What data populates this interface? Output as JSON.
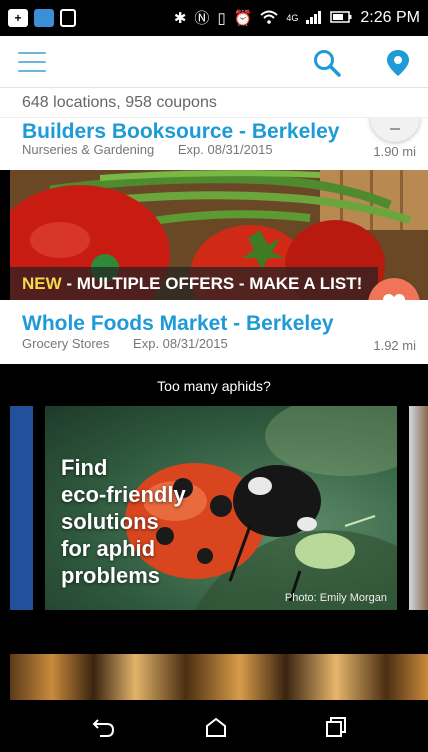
{
  "status_bar": {
    "time": "2:26 PM",
    "network": "4G",
    "icons": [
      "add-icon",
      "app-notification-icon",
      "document-icon",
      "bluetooth-icon",
      "nfc-icon",
      "vibrate-icon",
      "alarm-icon",
      "wifi-icon",
      "signal-icon",
      "battery-icon"
    ]
  },
  "header": {
    "icons": [
      "menu-icon",
      "search-icon",
      "location-pin-icon"
    ],
    "accent_color": "#1e9bd7"
  },
  "summary": {
    "locations_count": "648",
    "locations_label": "locations,",
    "coupons_count": "958",
    "coupons_label": "coupons"
  },
  "listings": [
    {
      "name": "Builders Booksource - Berkeley",
      "category": "Nurseries & Gardening",
      "expires": "Exp. 08/31/2015",
      "distance": "1.90 mi"
    },
    {
      "banner_new": "NEW",
      "banner_text": " - MULTIPLE OFFERS - MAKE A LIST!",
      "name": "Whole Foods Market - Berkeley",
      "category": "Grocery Stores",
      "expires": "Exp. 08/31/2015",
      "distance": "1.92 mi"
    }
  ],
  "promo": {
    "heading": "Too many aphids?",
    "card_lines": [
      "Find",
      "eco-friendly",
      "solutions",
      "for aphid",
      "problems"
    ],
    "credit": "Photo: Emily Morgan"
  },
  "colors": {
    "heart_button": "#ef7458",
    "banner_new": "#f6d84b",
    "link_blue": "#1e9bd7"
  },
  "nav_bar": {
    "icons": [
      "back-icon",
      "home-icon",
      "recent-apps-icon"
    ]
  }
}
